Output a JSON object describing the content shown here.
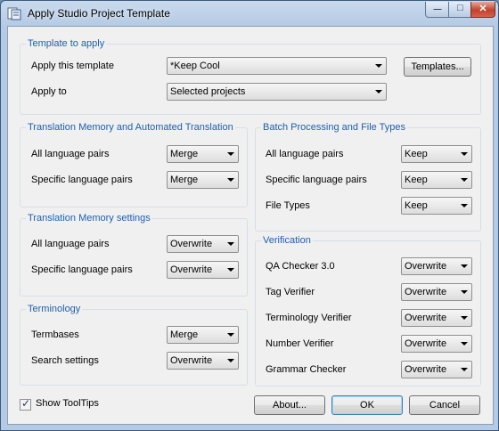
{
  "window": {
    "title": "Apply Studio Project Template",
    "controls": {
      "minimize": "—",
      "maximize": "□",
      "close": "✕"
    }
  },
  "template_group": {
    "legend": "Template to apply",
    "apply_template_label": "Apply this template",
    "apply_template_value": "*Keep Cool",
    "templates_button": "Templates...",
    "apply_to_label": "Apply to",
    "apply_to_value": "Selected projects"
  },
  "tm_automated": {
    "legend": "Translation Memory and Automated Translation",
    "rows": [
      {
        "label": "All language pairs",
        "value": "Merge"
      },
      {
        "label": "Specific language pairs",
        "value": "Merge"
      }
    ]
  },
  "tm_settings": {
    "legend": "Translation Memory settings",
    "rows": [
      {
        "label": "All language pairs",
        "value": "Overwrite"
      },
      {
        "label": "Specific language pairs",
        "value": "Overwrite"
      }
    ]
  },
  "terminology": {
    "legend": "Terminology",
    "rows": [
      {
        "label": "Termbases",
        "value": "Merge"
      },
      {
        "label": "Search settings",
        "value": "Overwrite"
      }
    ]
  },
  "batch": {
    "legend": "Batch Processing and File Types",
    "rows": [
      {
        "label": "All language pairs",
        "value": "Keep"
      },
      {
        "label": "Specific language pairs",
        "value": "Keep"
      },
      {
        "label": "File Types",
        "value": "Keep"
      }
    ]
  },
  "verification": {
    "legend": "Verification",
    "rows": [
      {
        "label": "QA Checker 3.0",
        "value": "Overwrite"
      },
      {
        "label": "Tag Verifier",
        "value": "Overwrite"
      },
      {
        "label": "Terminology Verifier",
        "value": "Overwrite"
      },
      {
        "label": "Number Verifier",
        "value": "Overwrite"
      },
      {
        "label": "Grammar Checker",
        "value": "Overwrite"
      }
    ]
  },
  "footer": {
    "show_tooltips_label": "Show ToolTips",
    "show_tooltips_checked": true,
    "about_button": "About...",
    "ok_button": "OK",
    "cancel_button": "Cancel"
  }
}
